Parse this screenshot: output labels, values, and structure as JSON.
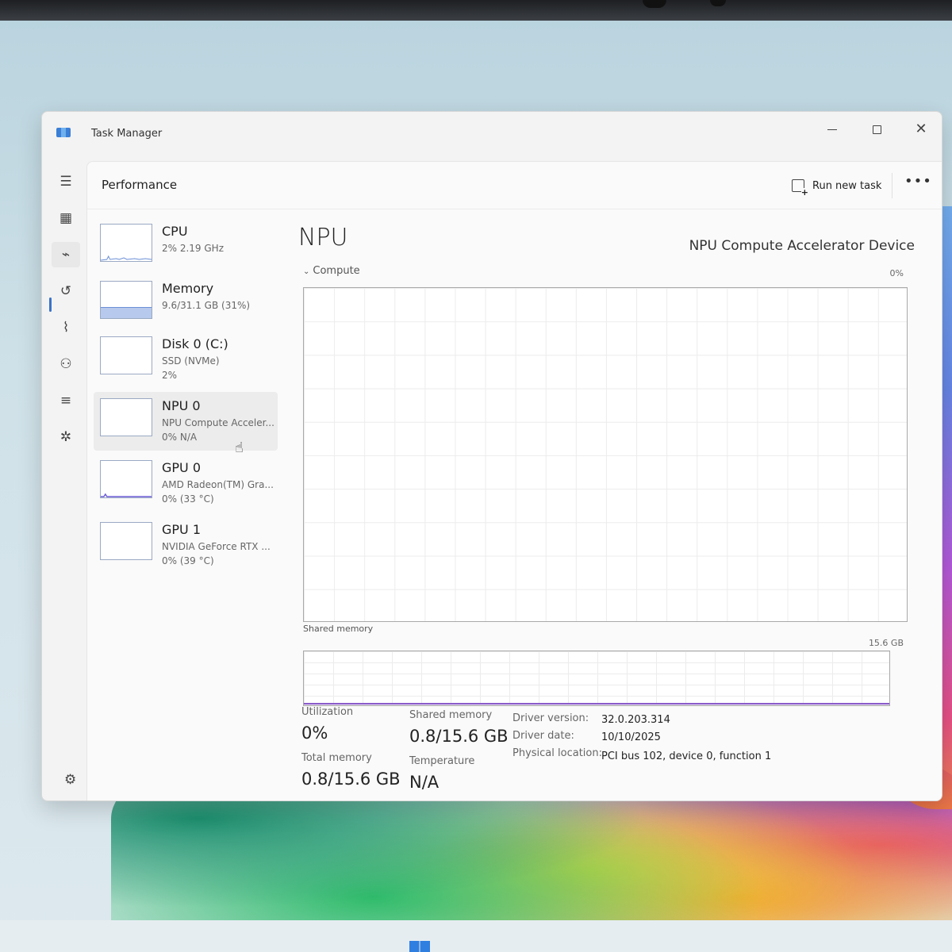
{
  "window": {
    "title": "Task Manager"
  },
  "header": {
    "page_title": "Performance",
    "run_new_task": "Run new task"
  },
  "resources": [
    {
      "name": "CPU",
      "sub": "2% 2.19 GHz",
      "sub2": "",
      "usage_fraction": 0.02
    },
    {
      "name": "Memory",
      "sub": "9.6/31.1 GB (31%)",
      "sub2": "",
      "usage_fraction": 0.31
    },
    {
      "name": "Disk 0 (C:)",
      "sub": "SSD (NVMe)",
      "sub2": "2%",
      "usage_fraction": 0.02
    },
    {
      "name": "NPU 0",
      "sub": "NPU Compute Acceler...",
      "sub2": "0% N/A",
      "usage_fraction": 0
    },
    {
      "name": "GPU 0",
      "sub": "AMD Radeon(TM) Gra...",
      "sub2": "0% (33 °C)",
      "usage_fraction": 0
    },
    {
      "name": "GPU 1",
      "sub": "NVIDIA GeForce RTX ...",
      "sub2": "0% (39 °C)",
      "usage_fraction": 0
    }
  ],
  "detail": {
    "title": "NPU",
    "device": "NPU Compute Accelerator Device",
    "compute_label": "Compute",
    "compute_max": "0%",
    "shared_label": "Shared memory",
    "shared_max": "15.6 GB",
    "shared_fraction": 0.05
  },
  "stats": {
    "utilization_label": "Utilization",
    "utilization_value": "0%",
    "shared_memory_label": "Shared memory",
    "shared_memory_value": "0.8/15.6 GB",
    "total_memory_label": "Total memory",
    "total_memory_value": "0.8/15.6 GB",
    "temperature_label": "Temperature",
    "temperature_value": "N/A"
  },
  "info": {
    "driver_version_label": "Driver version:",
    "driver_version_value": "32.0.203.314",
    "driver_date_label": "Driver date:",
    "driver_date_value": "10/10/2025",
    "physical_location_label": "Physical location:",
    "physical_location_value": "PCI bus 102, device 0, function 1"
  },
  "colors": {
    "accent": "#3a73c8",
    "memory_graph": "#8a5cc9",
    "thumb_border": "#9aa9c4"
  }
}
